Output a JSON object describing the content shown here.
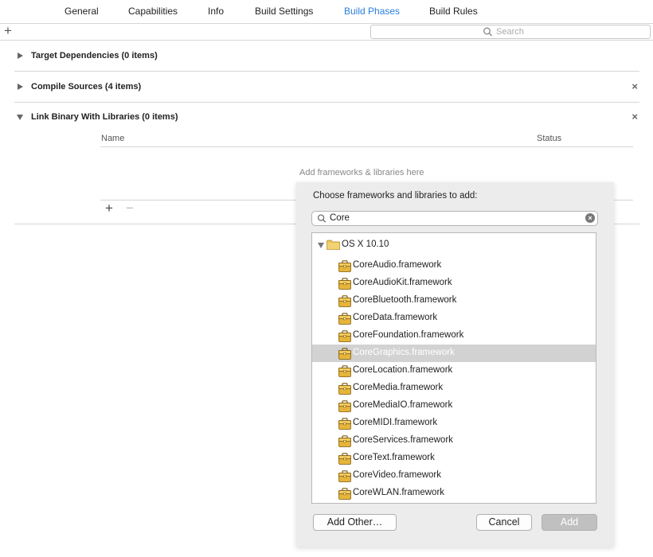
{
  "tabs": [
    {
      "label": "General"
    },
    {
      "label": "Capabilities"
    },
    {
      "label": "Info"
    },
    {
      "label": "Build Settings"
    },
    {
      "label": "Build Phases",
      "active": true
    },
    {
      "label": "Build Rules"
    }
  ],
  "toolbar": {
    "add_glyph": "+",
    "search_placeholder": "Search"
  },
  "phases": [
    {
      "title": "Target Dependencies (0 items)",
      "expanded": false,
      "closable": false
    },
    {
      "title": "Compile Sources (4 items)",
      "expanded": false,
      "closable": true
    },
    {
      "title": "Link Binary With Libraries (0 items)",
      "expanded": true,
      "closable": true
    }
  ],
  "link_table": {
    "columns": [
      "Name",
      "Status"
    ],
    "empty_hint": "Add frameworks & libraries here",
    "add_glyph": "+",
    "remove_glyph": "−"
  },
  "close_glyph": "×",
  "sheet": {
    "prompt": "Choose frameworks and libraries to add:",
    "search_value": "Core",
    "group_label": "OS X 10.10",
    "frameworks": [
      "CoreAudio.framework",
      "CoreAudioKit.framework",
      "CoreBluetooth.framework",
      "CoreData.framework",
      "CoreFoundation.framework",
      "CoreGraphics.framework",
      "CoreLocation.framework",
      "CoreMedia.framework",
      "CoreMediaIO.framework",
      "CoreMIDI.framework",
      "CoreServices.framework",
      "CoreText.framework",
      "CoreVideo.framework",
      "CoreWLAN.framework"
    ],
    "selected_framework": "CoreGraphics.framework",
    "buttons": {
      "add_other": "Add Other…",
      "cancel": "Cancel",
      "add": "Add"
    }
  },
  "colors": {
    "accent": "#2a7ddd",
    "selection": "#d2d2d2",
    "sheet_bg": "#ececec"
  }
}
